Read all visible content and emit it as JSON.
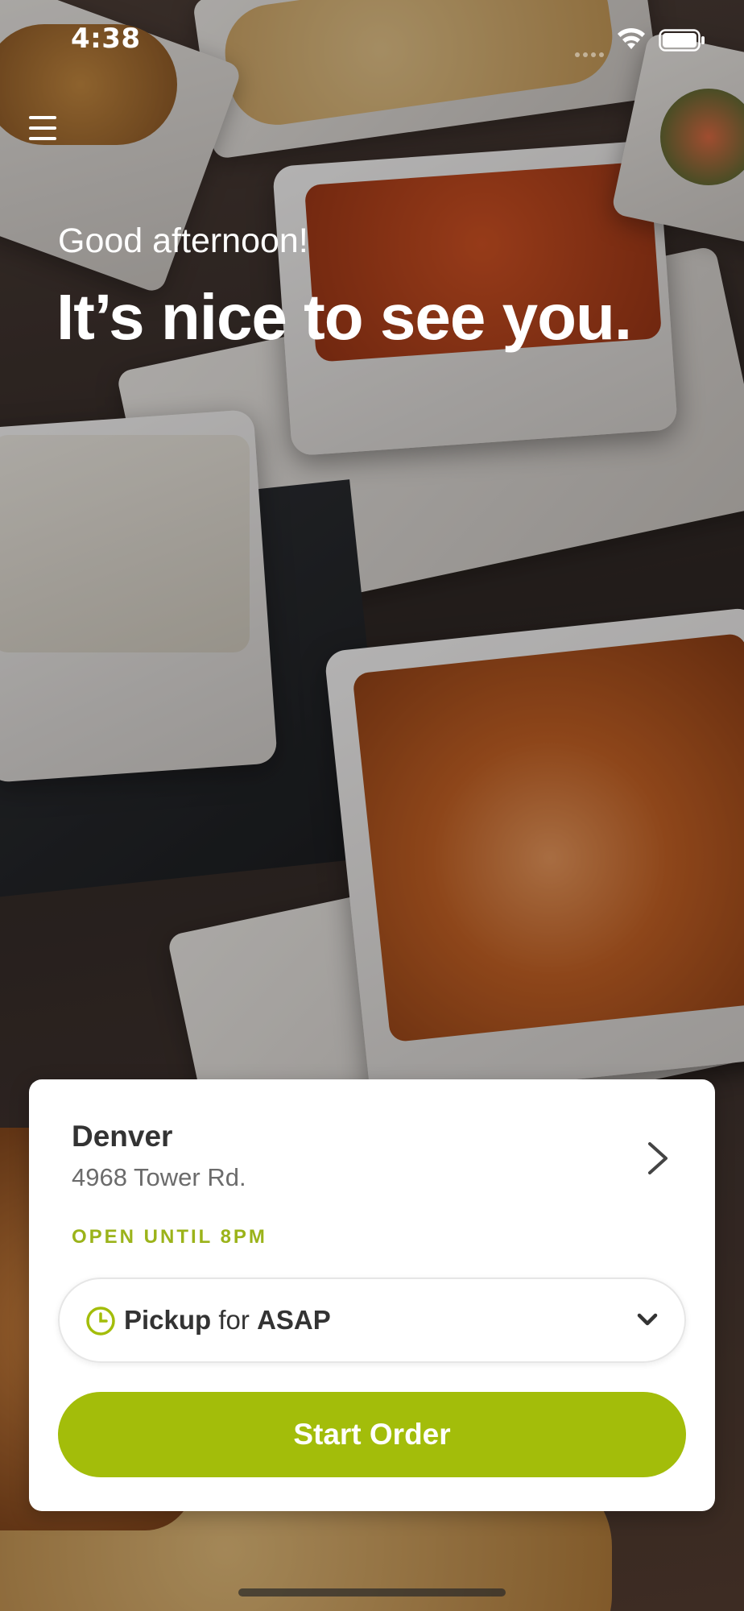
{
  "status_bar": {
    "time": "4:38"
  },
  "menu": {
    "icon": "hamburger-menu-icon"
  },
  "hero": {
    "greeting": "Good afternoon!",
    "headline": "It’s nice to see you."
  },
  "location_card": {
    "name": "Denver",
    "address": "4968 Tower Rd.",
    "hours_status": "OPEN UNTIL 8PM",
    "order_mode": {
      "method": "Pickup",
      "connector": "for",
      "time": "ASAP",
      "icon": "clock-icon"
    },
    "start_order_label": "Start Order"
  },
  "colors": {
    "accent": "#a3bd0a",
    "hours_text": "#9bb31a",
    "card_background": "#ffffff",
    "text_primary": "#333333",
    "text_secondary": "#6b6b6b"
  }
}
